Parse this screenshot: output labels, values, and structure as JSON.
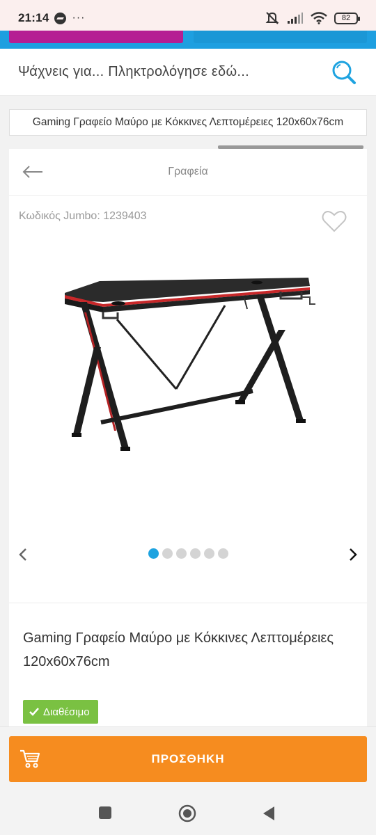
{
  "status_bar": {
    "time": "21:14",
    "more": "···",
    "battery": "82"
  },
  "search": {
    "placeholder": "Ψάχνεις για... Πληκτρολόγησε εδώ..."
  },
  "page": {
    "title": "Gaming Γραφείο Μαύρο με Κόκκινες Λεπτομέρειες 120x60x76cm"
  },
  "product": {
    "category": "Γραφεία",
    "code": "Κωδικός Jumbo: 1239403",
    "name": "Gaming Γραφείο Μαύρο με Κόκκινες Λεπτομέρειες 120x60x76cm",
    "availability": "Διαθέσιμο",
    "image_count": 6,
    "active_image": 1
  },
  "actions": {
    "add_to_cart": "ΠΡΟΣΘΗΚΗ"
  },
  "colors": {
    "accent_blue": "#1ea3e0",
    "brand_magenta": "#b51e93",
    "add_button": "#f68c1f",
    "available_badge": "#7ac142"
  }
}
